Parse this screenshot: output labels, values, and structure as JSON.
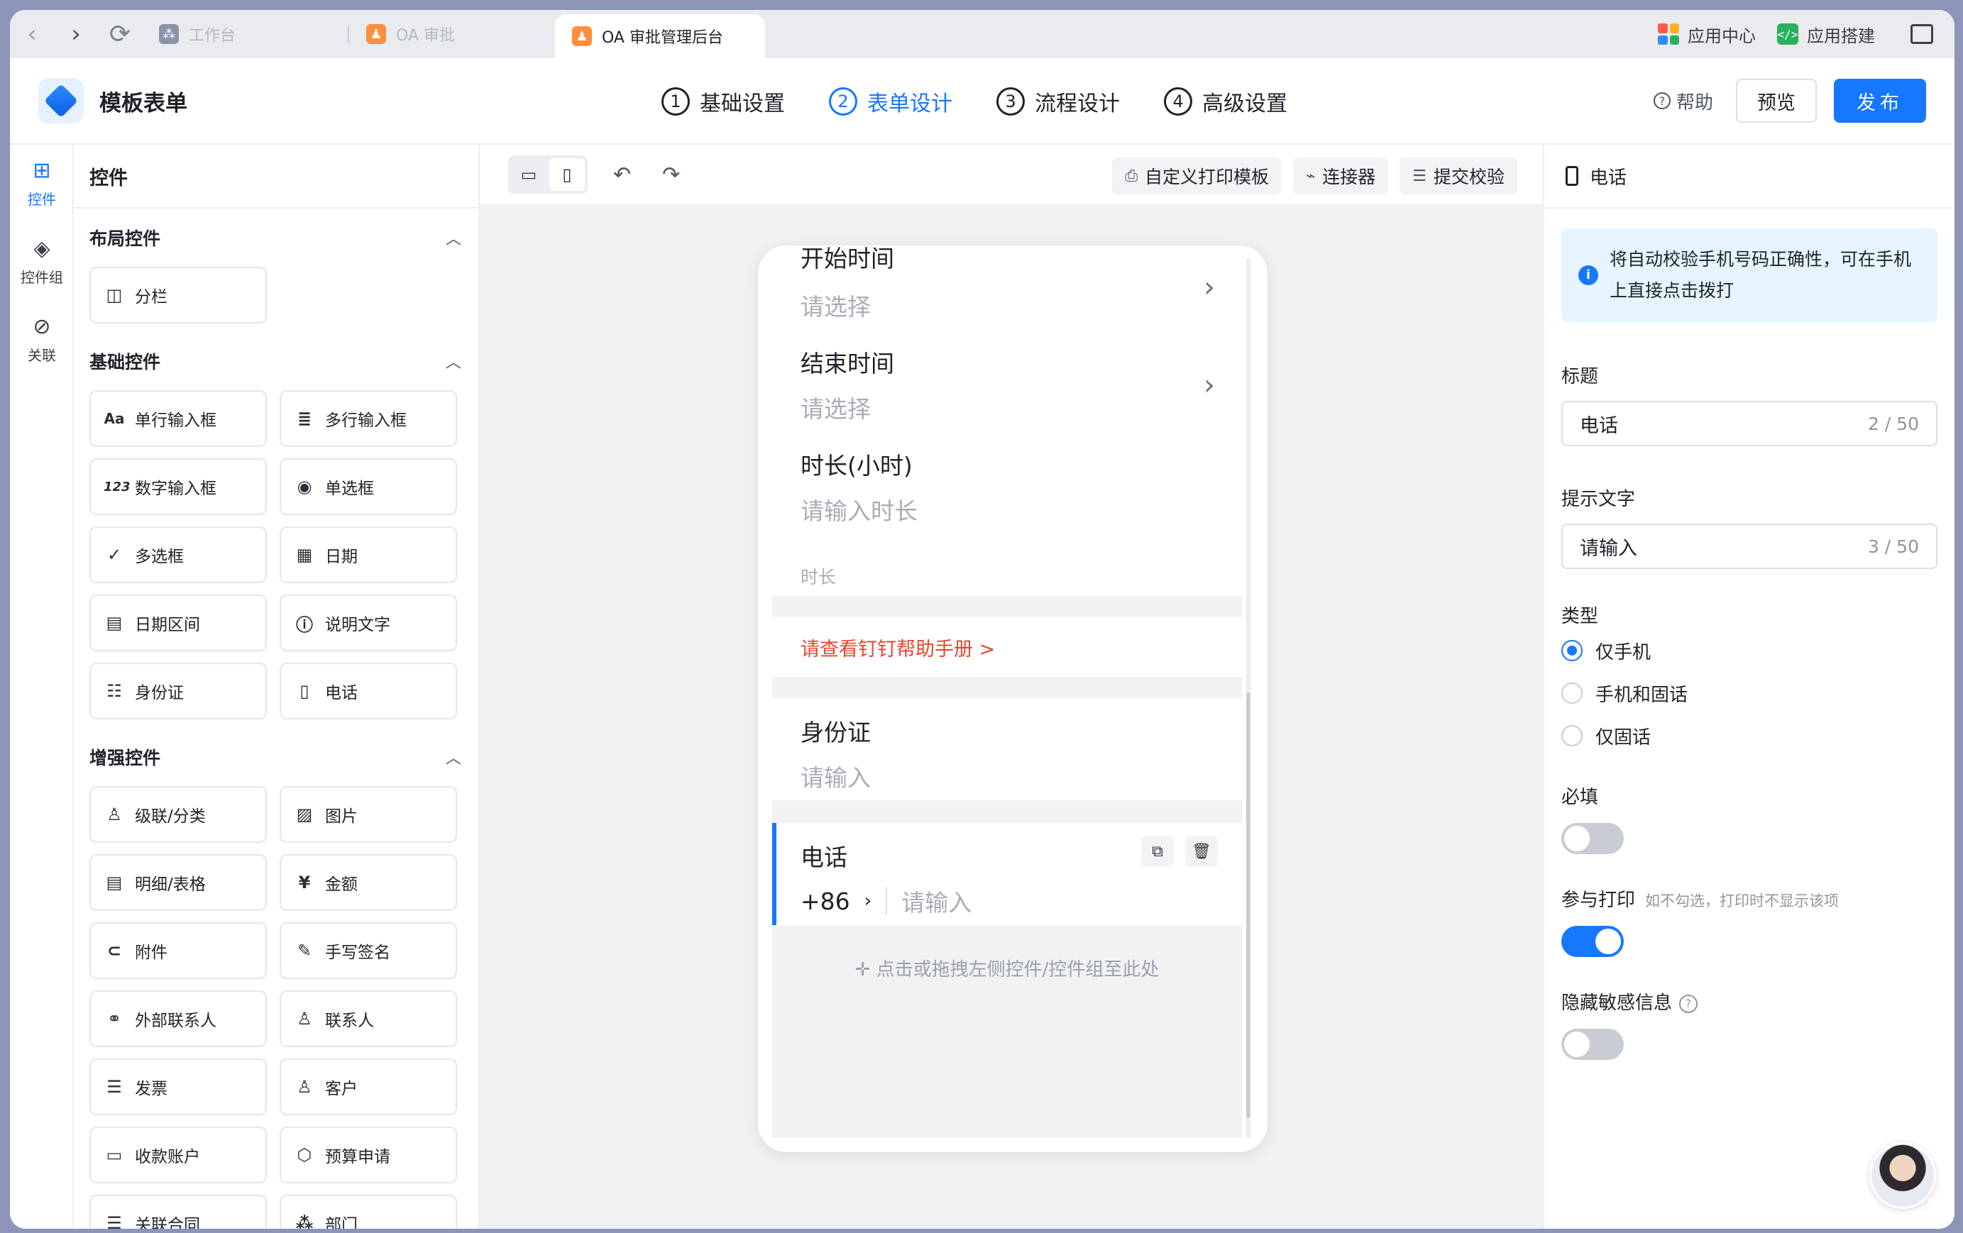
{
  "browser": {
    "tabs": [
      {
        "label": "工作台",
        "icon_color": "#8a94a8"
      },
      {
        "label": "OA 审批",
        "icon_color": "#ff8f3e"
      },
      {
        "label": "OA 审批管理后台",
        "icon_color": "#ff8f3e"
      }
    ],
    "right": {
      "app_center": "应用中心",
      "app_build": "应用搭建"
    }
  },
  "header": {
    "title": "模板表单",
    "steps": [
      {
        "num": "1",
        "label": "基础设置"
      },
      {
        "num": "2",
        "label": "表单设计"
      },
      {
        "num": "3",
        "label": "流程设计"
      },
      {
        "num": "4",
        "label": "高级设置"
      }
    ],
    "active_step": 2,
    "help": "帮助",
    "preview": "预览",
    "publish": "发布"
  },
  "rail": [
    {
      "label": "控件",
      "icon": "grid-icon"
    },
    {
      "label": "控件组",
      "icon": "layers-icon"
    },
    {
      "label": "关联",
      "icon": "link-icon"
    }
  ],
  "controls": {
    "title": "控件",
    "layout": {
      "title": "布局控件",
      "items": [
        "分栏"
      ]
    },
    "basic": {
      "title": "基础控件",
      "items": [
        "单行输入框",
        "多行输入框",
        "数字输入框",
        "单选框",
        "多选框",
        "日期",
        "日期区间",
        "说明文字",
        "身份证",
        "电话"
      ]
    },
    "enhanced": {
      "title": "增强控件",
      "items": [
        "级联/分类",
        "图片",
        "明细/表格",
        "金额",
        "附件",
        "手写签名",
        "外部联系人",
        "联系人",
        "发票",
        "客户",
        "收款账户",
        "预算申请",
        "关联合同",
        "部门"
      ]
    }
  },
  "toolbar": {
    "print": "自定义打印模板",
    "connector": "连接器",
    "validate": "提交校验"
  },
  "form": {
    "start": {
      "label": "开始时间",
      "placeholder": "请选择"
    },
    "end": {
      "label": "结束时间",
      "placeholder": "请选择"
    },
    "duration": {
      "label": "时长(小时)",
      "placeholder": "请输入时长",
      "note": "时长"
    },
    "help_link": "请查看钉钉帮助手册 >",
    "idcard": {
      "label": "身份证",
      "placeholder": "请输入"
    },
    "phone": {
      "label": "电话",
      "code": "+86",
      "placeholder": "请输入"
    },
    "drop_hint": "点击或拖拽左侧控件/控件组至此处"
  },
  "props": {
    "title": "电话",
    "tip": "将自动校验手机号码正确性，可在手机上直接点击拨打",
    "title_label": "标题",
    "title_value": "电话",
    "title_count": "2 / 50",
    "hint_label": "提示文字",
    "hint_value": "请输入",
    "hint_count": "3 / 50",
    "type_label": "类型",
    "types": [
      "仅手机",
      "手机和固话",
      "仅固话"
    ],
    "selected_type": 0,
    "required_label": "必填",
    "required": false,
    "print_label": "参与打印",
    "print_sub": "如不勾选，打印时不显示该项",
    "print": true,
    "sensitive_label": "隐藏敏感信息",
    "sensitive": false
  }
}
